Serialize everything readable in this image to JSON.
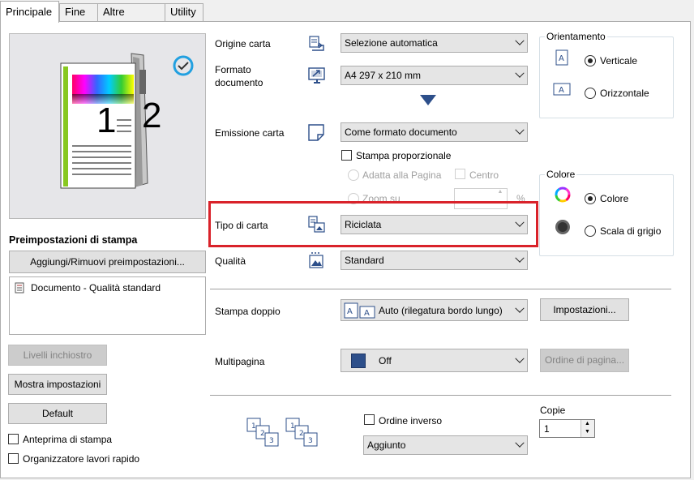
{
  "tabs": [
    "Principale",
    "Fine",
    "Altre opzioni",
    "Utility"
  ],
  "preview": {
    "page1": "1",
    "page2": "2"
  },
  "presets": {
    "title": "Preimpostazioni di stampa",
    "add_remove": "Aggiungi/Rimuovi preimpostazioni...",
    "list": [
      "Documento - Qualità standard"
    ]
  },
  "left_buttons": {
    "ink_levels": "Livelli inchiostro",
    "show_settings": "Mostra impostazioni",
    "default": "Default"
  },
  "left_checks": {
    "print_preview": "Anteprima di stampa",
    "quick_organizer": "Organizzatore lavori rapido"
  },
  "paper_source": {
    "label": "Origine carta",
    "value": "Selezione automatica"
  },
  "doc_size": {
    "label": "Formato documento",
    "line1": "Formato",
    "line2": "documento",
    "value": "A4 297 x 210 mm"
  },
  "paper_output": {
    "label": "Emissione carta",
    "value": "Come formato documento"
  },
  "proportional": {
    "label": "Stampa proporzionale",
    "fit_page": "Adatta alla Pagina",
    "center": "Centro",
    "zoom": "Zoom su",
    "percent": "%"
  },
  "paper_type": {
    "label": "Tipo di carta",
    "value": "Riciclata"
  },
  "quality": {
    "label": "Qualità",
    "value": "Standard"
  },
  "orientation": {
    "title": "Orientamento",
    "portrait": "Verticale",
    "landscape": "Orizzontale",
    "selected": "Verticale"
  },
  "color": {
    "title": "Colore",
    "color": "Colore",
    "grayscale": "Scala di grigio",
    "selected": "Colore"
  },
  "duplex": {
    "label": "Stampa doppio",
    "value": "Auto (rilegatura bordo lungo)",
    "settings_button": "Impostazioni..."
  },
  "multipage": {
    "label": "Multipagina",
    "value": "Off",
    "order_button": "Ordine di pagina..."
  },
  "order": {
    "reverse": "Ordine inverso",
    "collate_value": "Aggiunto",
    "copies_label": "Copie",
    "copies_value": "1"
  },
  "collate_icon_digits": [
    "1",
    "2",
    "3"
  ],
  "colors": {
    "highlight": "#d9222a",
    "accent": "#2d4f8a"
  }
}
